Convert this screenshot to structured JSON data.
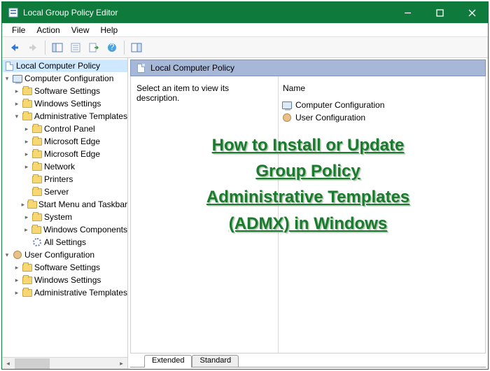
{
  "window": {
    "title": "Local Group Policy Editor"
  },
  "menu": {
    "file": "File",
    "action": "Action",
    "view": "View",
    "help": "Help"
  },
  "toolbar": {
    "back": "back-icon",
    "forward": "forward-icon",
    "up": "up-icon",
    "props": "properties-icon",
    "refresh": "refresh-icon",
    "export": "export-icon",
    "help": "help-icon",
    "show": "show-hide-icon"
  },
  "tree": {
    "root": "Local Computer Policy",
    "cc": "Computer Configuration",
    "cc_children": {
      "sw": "Software Settings",
      "ws": "Windows Settings",
      "at": "Administrative Templates",
      "at_children": {
        "cp": "Control Panel",
        "edge": "Microsoft Edge",
        "edge2": "Microsoft Edge",
        "net": "Network",
        "prn": "Printers",
        "srv": "Server",
        "start": "Start Menu and Taskbar",
        "sys": "System",
        "wc": "Windows Components",
        "all": "All Settings"
      }
    },
    "uc": "User Configuration",
    "uc_children": {
      "sw": "Software Settings",
      "ws": "Windows Settings",
      "at": "Administrative Templates"
    }
  },
  "right": {
    "header": "Local Computer Policy",
    "desc": "Select an item to view its description.",
    "colName": "Name",
    "items": {
      "cc": "Computer Configuration",
      "uc": "User Configuration"
    }
  },
  "tabs": {
    "extended": "Extended",
    "standard": "Standard"
  },
  "overlay": {
    "l1": "How to Install or Update ",
    "l2": "Group Policy ",
    "l3": "Administrative Templates ",
    "l4": "(ADMX) in Windows"
  }
}
